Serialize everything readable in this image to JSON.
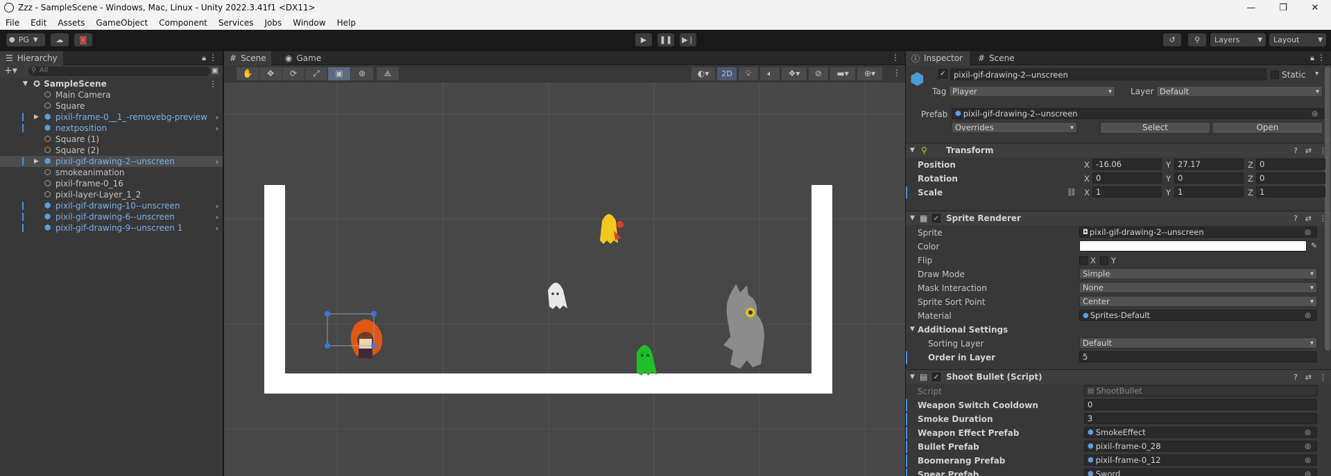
{
  "window": {
    "title": "Zzz - SampleScene - Windows, Mac, Linux - Unity 2022.3.41f1 <DX11>"
  },
  "menu": [
    "File",
    "Edit",
    "Assets",
    "GameObject",
    "Component",
    "Services",
    "Jobs",
    "Window",
    "Help"
  ],
  "toolbar": {
    "account": "PG",
    "layers": "Layers",
    "layout": "Layout"
  },
  "hierarchy": {
    "tab": "Hierarchy",
    "search_placeholder": "All",
    "scene": "SampleScene",
    "items": [
      {
        "label": "Main Camera",
        "prefab": false,
        "expandable": false
      },
      {
        "label": "Square",
        "prefab": false,
        "expandable": false
      },
      {
        "label": "pixil-frame-0__1_-removebg-preview",
        "prefab": true,
        "expandable": true
      },
      {
        "label": "nextposition",
        "prefab": true,
        "expandable": false
      },
      {
        "label": "Square (1)",
        "prefab": false,
        "expandable": false
      },
      {
        "label": "Square (2)",
        "prefab": false,
        "expandable": false
      },
      {
        "label": "pixil-gif-drawing-2--unscreen",
        "prefab": true,
        "expandable": true,
        "selected": true
      },
      {
        "label": "smokeanimation",
        "prefab": false,
        "expandable": false
      },
      {
        "label": "pixil-frame-0_16",
        "prefab": false,
        "expandable": false
      },
      {
        "label": "pixil-layer-Layer_1_2",
        "prefab": false,
        "expandable": false
      },
      {
        "label": "pixil-gif-drawing-10--unscreen",
        "prefab": true,
        "expandable": false
      },
      {
        "label": "pixil-gif-drawing-6--unscreen",
        "prefab": true,
        "expandable": false
      },
      {
        "label": "pixil-gif-drawing-9--unscreen 1",
        "prefab": true,
        "expandable": false
      }
    ]
  },
  "scene_view": {
    "tabs": [
      "Scene",
      "Game"
    ],
    "mode_2d": "2D"
  },
  "inspector": {
    "tabs": [
      "Inspector",
      "Scene"
    ],
    "object_name": "pixil-gif-drawing-2--unscreen",
    "static_label": "Static",
    "tag_label": "Tag",
    "tag": "Player",
    "layer_label": "Layer",
    "layer": "Default",
    "prefab_label": "Prefab",
    "prefab_value": "pixil-gif-drawing-2--unscreen",
    "overrides": "Overrides",
    "select": "Select",
    "open": "Open",
    "transform": {
      "title": "Transform",
      "position_label": "Position",
      "position": {
        "x": "-16.06",
        "y": "27.17",
        "z": "0"
      },
      "rotation_label": "Rotation",
      "rotation": {
        "x": "0",
        "y": "0",
        "z": "0"
      },
      "scale_label": "Scale",
      "scale": {
        "x": "1",
        "y": "1",
        "z": "1"
      }
    },
    "sprite_renderer": {
      "title": "Sprite Renderer",
      "sprite_label": "Sprite",
      "sprite": "pixil-gif-drawing-2--unscreen",
      "color_label": "Color",
      "color": "#ffffff",
      "flip_label": "Flip",
      "flip_x": "X",
      "flip_y": "Y",
      "draw_mode_label": "Draw Mode",
      "draw_mode": "Simple",
      "mask_label": "Mask Interaction",
      "mask": "None",
      "sort_point_label": "Sprite Sort Point",
      "sort_point": "Center",
      "material_label": "Material",
      "material": "Sprites-Default",
      "additional_label": "Additional Settings",
      "sorting_layer_label": "Sorting Layer",
      "sorting_layer": "Default",
      "order_label": "Order in Layer",
      "order": "5"
    },
    "shoot_bullet": {
      "title": "Shoot Bullet (Script)",
      "script_label": "Script",
      "script": "ShootBullet",
      "cooldown_label": "Weapon Switch Cooldown",
      "cooldown": "0",
      "smoke_label": "Smoke Duration",
      "smoke": "3",
      "effect_label": "Weapon Effect Prefab",
      "effect": "SmokeEffect",
      "bullet_label": "Bullet Prefab",
      "bullet": "pixil-frame-0_28",
      "boomerang_label": "Boomerang Prefab",
      "boomerang": "pixil-frame-0_12",
      "spear_label": "Spear Prefab",
      "spear": "Sword"
    }
  }
}
